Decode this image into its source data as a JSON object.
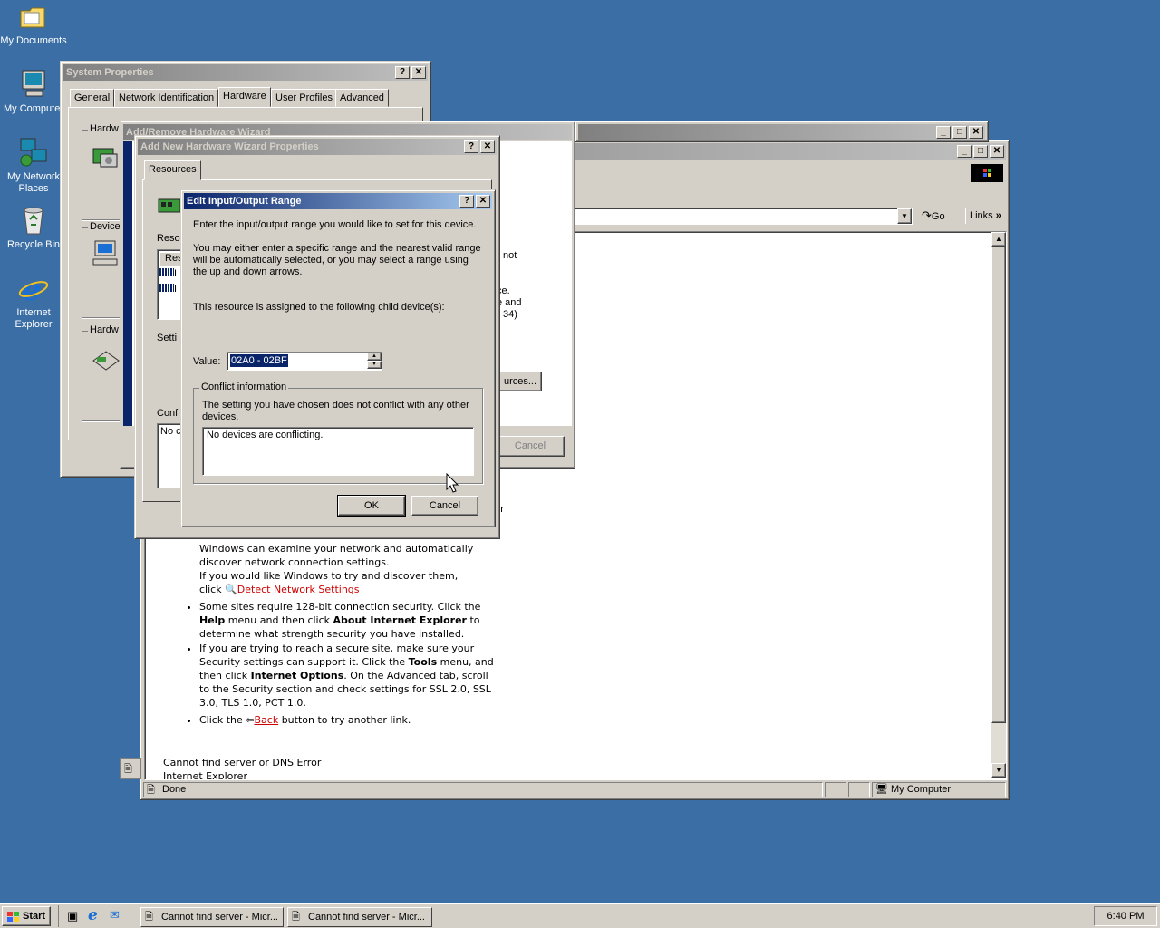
{
  "desktop": {
    "icons": [
      {
        "label": "My Documents"
      },
      {
        "label": "My Computer"
      },
      {
        "label": "My Network Places"
      },
      {
        "label": "Recycle Bin"
      },
      {
        "label": "Internet Explorer"
      }
    ]
  },
  "sysprops": {
    "title": "System Properties",
    "tabs": [
      "General",
      "Network Identification",
      "Hardware",
      "User Profiles",
      "Advanced"
    ],
    "groups": [
      "Hardw",
      "Device",
      "Hardw"
    ]
  },
  "wizard": {
    "title": "Add/Remove Hardware Wizard",
    "partial_text": [
      "not",
      "ce.",
      "e and",
      "34)"
    ],
    "resources_btn": "urces...",
    "cancel": "Cancel"
  },
  "props": {
    "title": "Add New Hardware Wizard Properties",
    "tab": "Resources",
    "labels": [
      "Resou",
      "Setti",
      "Confli"
    ],
    "list_head": "Res",
    "list_items": [
      "I",
      "I"
    ],
    "conflict_partial": "No c"
  },
  "dialog": {
    "title": "Edit Input/Output Range",
    "intro": "Enter the input/output range you would like to set for this device.",
    "desc": "You may either enter a specific range and the nearest valid range will be automatically selected, or you may select a range using the up and down arrows.",
    "child": "This resource is assigned to the following child device(s):",
    "value_label": "Value:",
    "value": "02A0 - 02BF",
    "conflict_group": "Conflict information",
    "conflict_text": "The setting you have chosen does not conflict with any other devices.",
    "conflict_box": "No devices are conflicting.",
    "ok": "OK",
    "cancel": "Cancel"
  },
  "ie": {
    "go": "Go",
    "links": "Links",
    "r": "r",
    "body": {
      "p1_l1": "Windows can examine your network and automatically",
      "p1_l2": "discover network connection settings.",
      "p1_l3": "If you would like Windows to try and discover them,",
      "p1_l4": "click",
      "detect_link": "Detect Network Settings",
      "b2_l1": "Some sites require 128-bit connection security. Click the",
      "b2_l2a": "Help",
      "b2_l2b": " menu and then click ",
      "b2_l2c": "About Internet Explorer",
      "b2_l2d": " to",
      "b2_l3": "determine what strength security you have installed.",
      "b3_l1": "If you are trying to reach a secure site, make sure your",
      "b3_l2a": "Security settings can support it. Click the ",
      "b3_l2b": "Tools",
      "b3_l2c": " menu, and",
      "b3_l3a": "then click ",
      "b3_l3b": "Internet Options",
      "b3_l3c": ". On the Advanced tab, scroll",
      "b3_l4": "to the Security section and check settings for SSL 2.0, SSL",
      "b3_l5": "3.0, TLS 1.0, PCT 1.0.",
      "b4_a": "Click the",
      "back_link": "Back",
      "b4_b": "button to try another link.",
      "footer1": "Cannot find server or DNS Error",
      "footer2": "Internet Explorer"
    },
    "status": "Done",
    "zone": "My Computer"
  },
  "taskbar": {
    "start": "Start",
    "tasks": [
      "Cannot find server - Micr...",
      "Cannot find server - Micr..."
    ],
    "clock": "6:40 PM"
  }
}
